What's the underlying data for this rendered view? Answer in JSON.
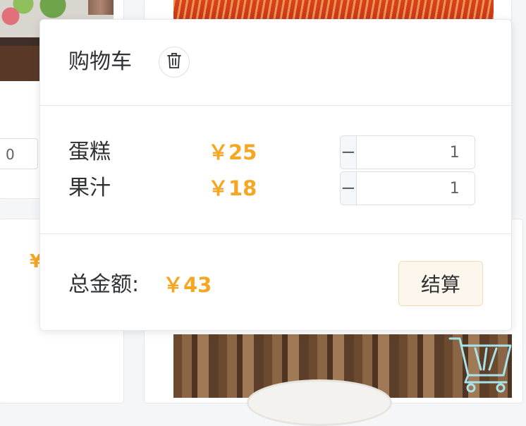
{
  "background": {
    "stepper_value": "0",
    "price_peek": "¥"
  },
  "cart": {
    "title": "购物车",
    "items": [
      {
        "name": "蛋糕",
        "price": "￥25",
        "quantity": "1",
        "minus": "−",
        "plus": "+"
      },
      {
        "name": "果汁",
        "price": "￥18",
        "quantity": "1",
        "minus": "−",
        "plus": "+"
      }
    ],
    "total_label": "总金额:",
    "total_value": "￥43",
    "checkout_label": "结算"
  },
  "icons": {
    "clear": "trash-icon",
    "cart": "shopping-cart-icon"
  },
  "colors": {
    "price": "#f5a623",
    "checkout_bg": "#fdf6ec",
    "cart_fab": "#a8e3ea"
  }
}
